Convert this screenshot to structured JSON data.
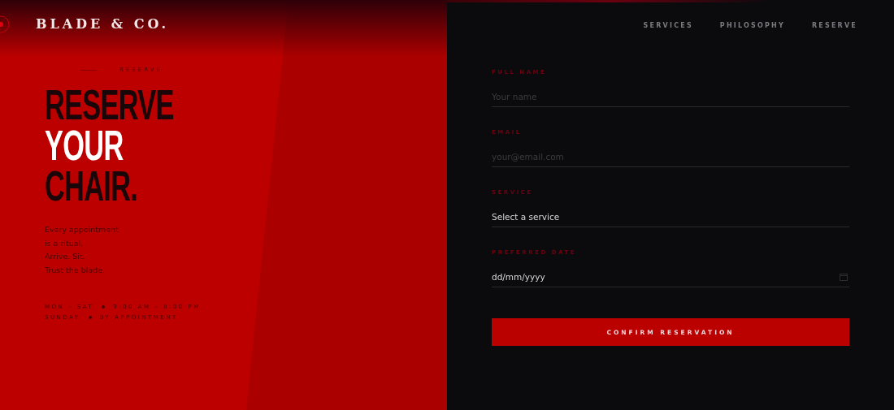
{
  "brand": "BLADE & CO.",
  "nav": [
    "SERVICES",
    "PHILOSOPHY",
    "RESERVE"
  ],
  "eyebrow": "RESERVE",
  "headline": [
    {
      "text": "RESERVE",
      "highlight": false
    },
    {
      "text": "YOUR",
      "highlight": true
    },
    {
      "text": "CHAIR.",
      "highlight": false
    }
  ],
  "intro": [
    "Every appointment",
    "is a ritual.",
    "Arrive. Sit.",
    "Trust the blade."
  ],
  "hours": [
    {
      "days": "MON – SAT",
      "time": "9:00 AM – 8:00 PM"
    },
    {
      "days": "SUNDAY",
      "time": "BY APPOINTMENT"
    }
  ],
  "form": {
    "fields": [
      {
        "label": "FULL NAME",
        "kind": "text",
        "placeholder": "Your name"
      },
      {
        "label": "EMAIL",
        "kind": "text",
        "placeholder": "your@email.com"
      },
      {
        "label": "SERVICE",
        "kind": "select",
        "value": "Select a service"
      },
      {
        "label": "PREFERRED DATE",
        "kind": "date",
        "value": "dd/mm/yyyy"
      }
    ],
    "submit": "CONFIRM RESERVATION"
  }
}
